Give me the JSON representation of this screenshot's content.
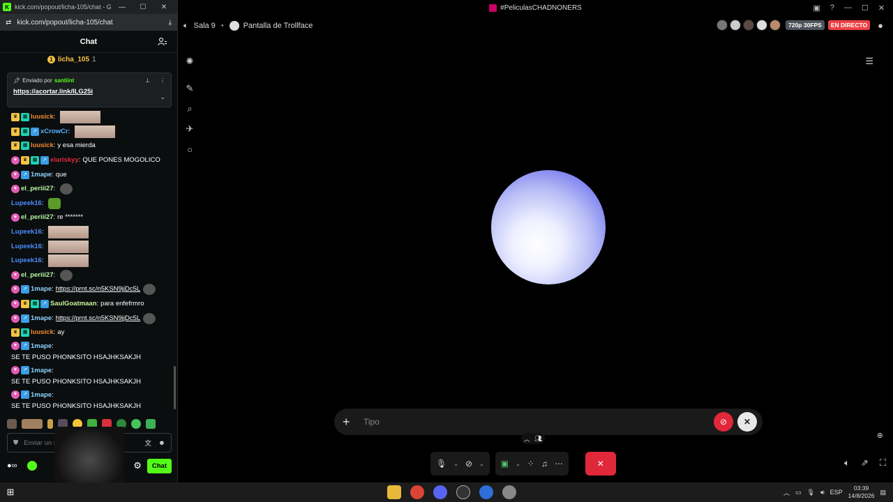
{
  "browser": {
    "title": "kick.com/popout/licha-105/chat - Go...",
    "url": "kick.com/popout/licha-105/chat"
  },
  "chat": {
    "header": "Chat",
    "top_gifter": {
      "name": "licha_105",
      "count": "1"
    },
    "pinned": {
      "prefix": "Enviado por",
      "author": "santiint",
      "link": "https://acortar.link/ILG25i"
    },
    "messages": [
      {
        "badges": [
          "crown",
          "gift"
        ],
        "user": "luusick",
        "color": "#f28a2e",
        "text": "",
        "image": true
      },
      {
        "badges": [
          "crown",
          "gift",
          "arrow"
        ],
        "user": "xCrowCr",
        "color": "#5ab3ff",
        "text": "",
        "image": true
      },
      {
        "badges": [
          "crown",
          "gift"
        ],
        "user": "luusick",
        "color": "#f28a2e",
        "text": "y esa mierda"
      },
      {
        "badges": [
          "sub",
          "crown",
          "gift",
          "arrow"
        ],
        "user": "elariskyy",
        "color": "#e0283a",
        "text": "QUE PONES MOGOLICO"
      },
      {
        "badges": [
          "sub",
          "arrow"
        ],
        "user": "1mape",
        "color": "#8fd3ff",
        "text": "que"
      },
      {
        "badges": [
          "sub"
        ],
        "user": "el_periii27",
        "color": "#b7f5a9",
        "text": "",
        "emote": "skull"
      },
      {
        "badges": [],
        "user": "Lupeek16",
        "color": "#4b8cff",
        "text": "",
        "emote": "frog"
      },
      {
        "badges": [
          "sub"
        ],
        "user": "el_periii27",
        "color": "#b7f5a9",
        "text": "re *******"
      },
      {
        "badges": [],
        "user": "Lupeek16",
        "color": "#4b8cff",
        "text": "",
        "image": true
      },
      {
        "badges": [],
        "user": "Lupeek16",
        "color": "#4b8cff",
        "text": "",
        "image": true
      },
      {
        "badges": [],
        "user": "Lupeek16",
        "color": "#4b8cff",
        "text": "",
        "image": true
      },
      {
        "badges": [
          "sub"
        ],
        "user": "el_periii27",
        "color": "#b7f5a9",
        "text": "",
        "emote": "skull"
      },
      {
        "badges": [
          "sub",
          "arrow"
        ],
        "user": "1mape",
        "color": "#8fd3ff",
        "text": "",
        "link": "https://prnt.sc/n5KSN9jjDc5L",
        "emote": "skull"
      },
      {
        "badges": [
          "sub",
          "crown",
          "gift",
          "arrow"
        ],
        "user": "SaulGoatmaan",
        "color": "#c8f59a",
        "text": "para enfefrmro"
      },
      {
        "badges": [
          "sub",
          "arrow"
        ],
        "user": "1mape",
        "color": "#8fd3ff",
        "text": "",
        "link": "https://prnt.sc/n5KSN9jjDc5L",
        "emote": "skull"
      },
      {
        "badges": [
          "crown",
          "gift"
        ],
        "user": "luusick",
        "color": "#f28a2e",
        "text": "ay"
      },
      {
        "badges": [
          "sub",
          "arrow"
        ],
        "user": "1mape",
        "color": "#8fd3ff",
        "text": "SE TE PUSO PHONKSITO HSAJHKSAKJH",
        "tall": true
      },
      {
        "badges": [
          "sub",
          "arrow"
        ],
        "user": "1mape",
        "color": "#8fd3ff",
        "text": "SE TE PUSO PHONKSITO HSAJHKSAKJH",
        "tall": true
      },
      {
        "badges": [
          "sub",
          "arrow"
        ],
        "user": "1mape",
        "color": "#8fd3ff",
        "text": "SE TE PUSO PHONKSITO HSAJHKSAKJH",
        "tall": true
      }
    ],
    "input_placeholder": "Enviar un mensaje",
    "send_label": "Chat"
  },
  "stage": {
    "window_title": "#PeliculasCHADNONERS",
    "room": "Sala 9",
    "stream_title": "Pantalla de Trollface",
    "quality": "720p 30FPS",
    "live": "EN DIRECTO",
    "composer_placeholder": "Tipo"
  },
  "taskbar": {
    "lang": "ESP",
    "time": "03:39",
    "date": "14/8/2026"
  }
}
